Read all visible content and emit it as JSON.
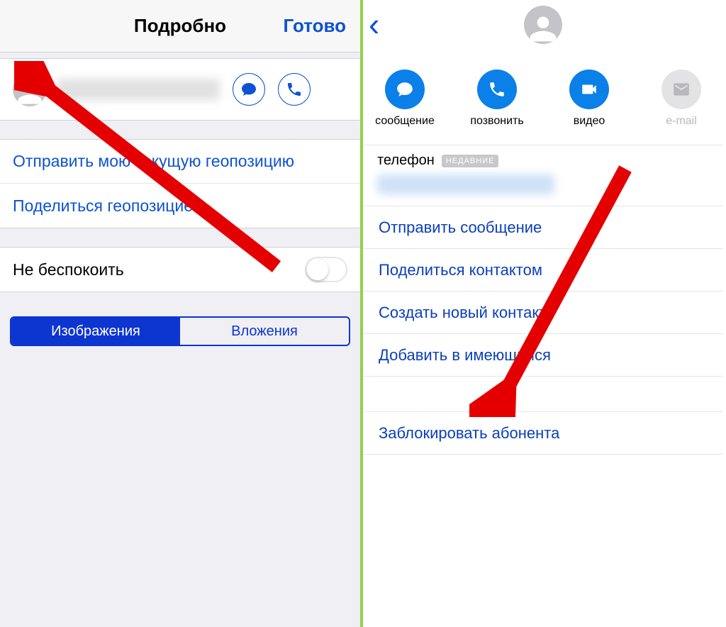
{
  "left": {
    "header": {
      "title": "Подробно",
      "done": "Готово"
    },
    "actions": {
      "send_location": "Отправить мою текущую геопозицию",
      "share_location": "Поделиться геопозицией"
    },
    "dnd": {
      "label": "Не беспокоить",
      "on": false
    },
    "segmented": {
      "images": "Изображения",
      "attachments": "Вложения",
      "active": "images"
    }
  },
  "right": {
    "action_buttons": {
      "message": "сообщение",
      "call": "позвонить",
      "video": "видео",
      "email": "e-mail"
    },
    "phone_section": {
      "label": "телефон",
      "badge": "НЕДАВНИЕ"
    },
    "rows": {
      "send_message": "Отправить сообщение",
      "share_contact": "Поделиться контактом",
      "create_contact": "Создать новый контакт",
      "add_existing": "Добавить в имеющийся",
      "block": "Заблокировать абонента"
    }
  }
}
